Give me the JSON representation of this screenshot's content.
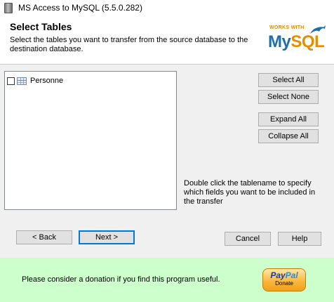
{
  "window": {
    "title": "MS Access to MySQL (5.5.0.282)",
    "icon": "app-icon"
  },
  "header": {
    "title": "Select Tables",
    "subtitle": "Select the tables you want to transfer from the source database to the destination database.",
    "logo": {
      "top_text": "WORKS WITH",
      "my": "My",
      "sql": "SQL"
    }
  },
  "tables": [
    {
      "name": "Personne",
      "checked": false,
      "icon": "table-icon"
    }
  ],
  "buttons": {
    "select_all": "Select All",
    "select_none": "Select None",
    "expand_all": "Expand All",
    "collapse_all": "Collapse All",
    "back": "< Back",
    "next": "Next >",
    "cancel": "Cancel",
    "help": "Help"
  },
  "hint": "Double click the tablename to specify which fields you want to be included in the transfer",
  "donation": {
    "message": "Please consider a donation if you find this program useful.",
    "paypal_pay": "Pay",
    "paypal_pal": "Pal",
    "paypal_donate": "Donate"
  },
  "colors": {
    "donation_background": "#ccffcc",
    "mysql_blue": "#1d6ea9",
    "mysql_orange": "#e48e00"
  }
}
